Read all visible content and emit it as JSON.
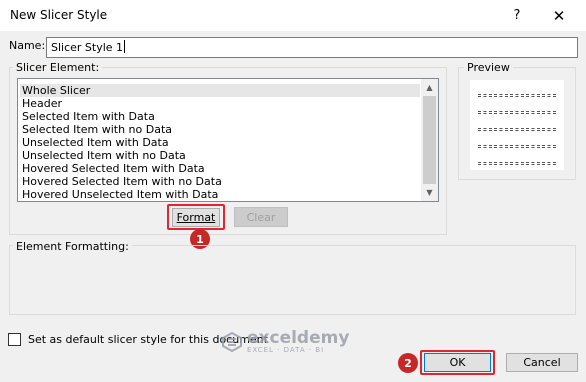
{
  "window": {
    "title": "New Slicer Style",
    "help_glyph": "?",
    "close_glyph": "✕"
  },
  "name_field": {
    "label": "Name:",
    "value": "Slicer Style 1"
  },
  "slicer_element": {
    "group_label": "Slicer Element:",
    "items": [
      "Whole Slicer",
      "Header",
      "Selected Item with Data",
      "Selected Item with no Data",
      "Unselected Item with Data",
      "Unselected Item with no Data",
      "Hovered Selected Item with Data",
      "Hovered Selected Item with no Data",
      "Hovered Unselected Item with Data"
    ],
    "selected_item": "Whole Slicer",
    "scroll_up_glyph": "▲",
    "scroll_down_glyph": "▼",
    "format_label": "Format",
    "clear_label": "Clear"
  },
  "preview": {
    "group_label": "Preview"
  },
  "element_formatting": {
    "group_label": "Element Formatting:"
  },
  "default_checkbox": {
    "label": "Set as default slicer style for this document",
    "checked": false
  },
  "footer": {
    "ok_label": "OK",
    "cancel_label": "Cancel"
  },
  "annotations": {
    "badge_1": "1",
    "badge_2": "2",
    "highlight_color": "#e0262e",
    "badge_color": "#c62828"
  },
  "watermark": {
    "brand": "exceldemy",
    "tagline": "EXCEL · DATA · BI"
  }
}
